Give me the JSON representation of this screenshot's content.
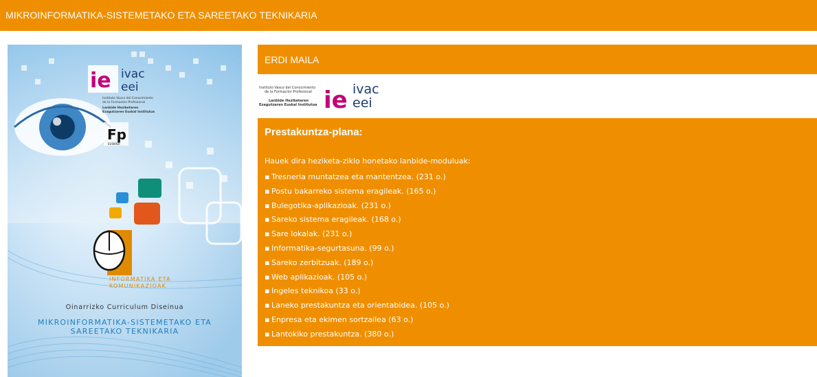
{
  "header": {
    "title": "MIKROINFORMATIKA-SISTEMETAKO ETA SAREETAKO TEKNIKARIA"
  },
  "cover": {
    "logo_ie": "ie",
    "logo_ivac": "ivac",
    "logo_eei": "eei",
    "institute_lines": [
      "Instituto Vasco del Conocimiento",
      "de la Formación Profesional",
      "Lanbide Heziketaren",
      "Ezagutzaren Euskal Institutua"
    ],
    "fp_logo": "Fp",
    "fp_sub": "EUSKADI",
    "family_line1": "INFORMATIKA ETA",
    "family_line2": "KOMUNIKAZIOAK",
    "curriculum": "Oinarrizko Curriculum Diseinua",
    "title_line1": "MIKROINFORMATIKA-SISTEMETAKO ETA",
    "title_line2": "SAREETAKO TEKNIKARIA"
  },
  "level": {
    "label": "ERDI MAILA"
  },
  "institute_logo": {
    "text_lines": [
      "Instituto Vasco del Conocimiento",
      "de la Formación Profesional",
      "Lanbide Heziketaren",
      "Ezagutzaren Euskal Institutua"
    ],
    "ie": "ie",
    "ivac": "ivac",
    "eei": "eei"
  },
  "plan": {
    "title": "Prestakuntza-plana:",
    "intro": "Hauek dira heziketa-ziklo honetako lanbide-moduluak:",
    "bullet": "▪",
    "modules": [
      "Tresneria muntatzea eta mantentzea. (231 o.)",
      "Postu bakarreko sistema eragileak. (165 o.)",
      "Bulegotika-aplikazioak. (231 o.)",
      "Sareko sistema eragileak. (168 o.)",
      "Sare lokalak. (231 o.)",
      "Informatika-segurtasuna. (99 o.)",
      "Sareko zerbitzuak. (189 o.)",
      "Web aplikazioak. (105 o.)",
      "Ingeles teknikoa (33 o.)",
      "Laneko prestakuntza eta orientabidea. (105 o.)",
      "Enpresa eta ekimen sortzailea (63 o.)",
      "Lantokiko prestakuntza. (380 o.)"
    ]
  },
  "colors": {
    "accent": "#ef8f00",
    "cover_blue": "#1f7ec0"
  }
}
